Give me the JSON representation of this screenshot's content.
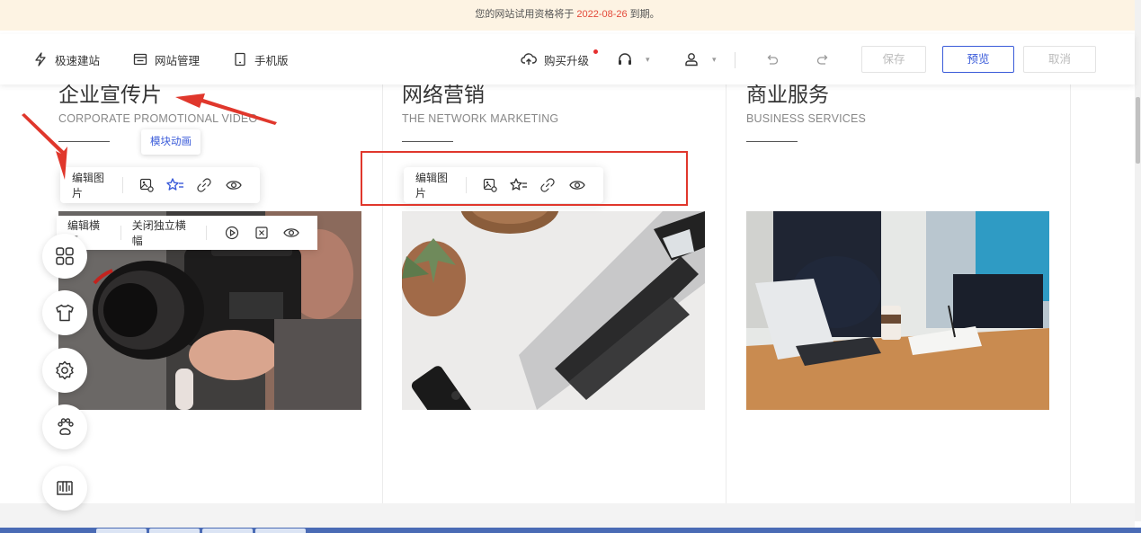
{
  "banner": {
    "prefix": "您的网站试用资格将于",
    "date": "2022-08-26",
    "suffix": "到期。"
  },
  "toolbar": {
    "quick_build": "极速建站",
    "site_manage": "网站管理",
    "mobile": "手机版",
    "buy_upgrade": "购买升级",
    "save": "保存",
    "preview": "预览",
    "cancel": "取消"
  },
  "cards": [
    {
      "title": "企业宣传片",
      "subtitle": "CORPORATE PROMOTIONAL VIDEO"
    },
    {
      "title": "网络营销",
      "subtitle": "THE NETWORK MARKETING"
    },
    {
      "title": "商业服务",
      "subtitle": "BUSINESS SERVICES"
    }
  ],
  "image_toolbar": {
    "edit_image": "编辑图片",
    "tooltip": "模块动画"
  },
  "banner_toolbar": {
    "edit_banner": "编辑横幅",
    "close_banner": "关闭独立横幅"
  },
  "colors": {
    "accent": "#3a5bd9",
    "highlight": "#e0372c",
    "banner_bg": "#fdf3e3"
  },
  "icons": [
    "lightning-icon",
    "site-manage-icon",
    "mobile-icon",
    "upload-cloud-icon",
    "headset-icon",
    "user-icon",
    "undo-icon",
    "redo-icon",
    "edit-image-icon",
    "star-list-icon",
    "link-icon",
    "eye-icon",
    "play-icon",
    "layout-icon",
    "grid-icon",
    "shirt-icon",
    "gear-icon",
    "paw-icon",
    "book-icon"
  ]
}
